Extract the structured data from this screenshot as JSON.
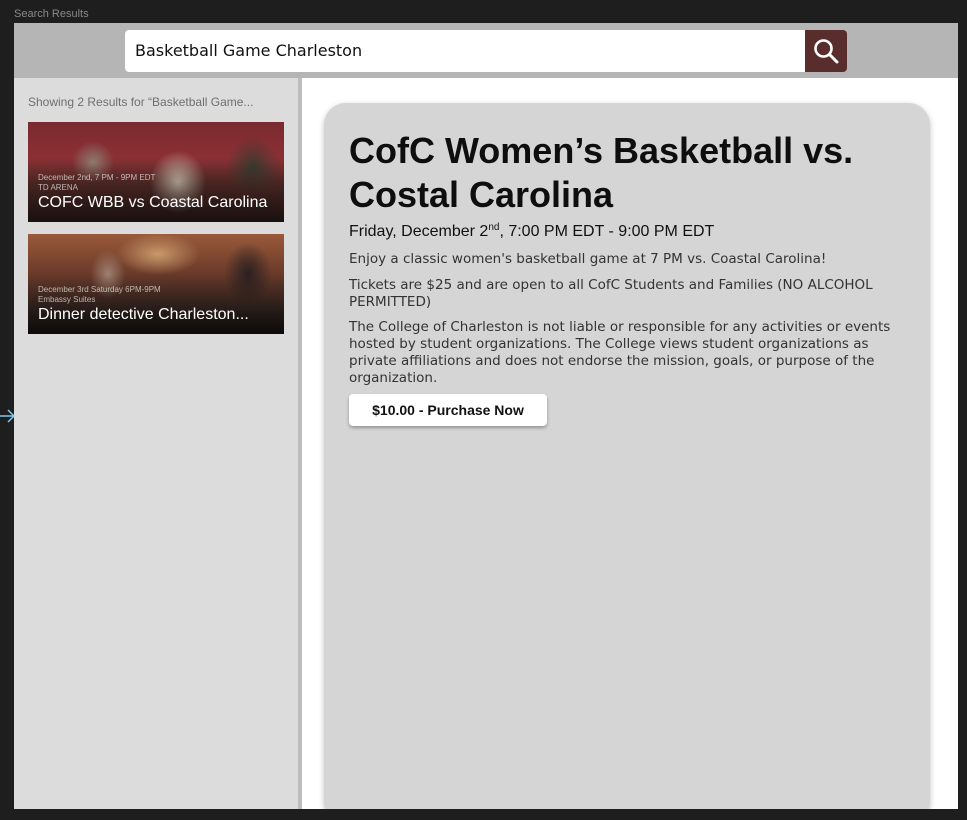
{
  "canvas": {
    "frame_label": "Search Results"
  },
  "search": {
    "value": "Basketball Game Charleston"
  },
  "sidebar": {
    "summary": "Showing 2 Results for “Basketball Game...",
    "results": [
      {
        "meta_line1": "December 2nd, 7 PM - 9PM EDT",
        "meta_line2": "TD ARENA",
        "title": "COFC WBB vs Coastal Carolina"
      },
      {
        "meta_line1": "December 3rd Saturday 6PM-9PM",
        "meta_line2": "Embassy Suites",
        "title": "Dinner detective Charleston..."
      }
    ]
  },
  "detail": {
    "title": "CofC Women’s Basketball vs. Costal Carolina",
    "time_prefix": "Friday, December 2",
    "time_sup": "nd",
    "time_suffix": ", 7:00 PM EDT - 9:00 PM EDT",
    "paragraphs": [
      "Enjoy a classic women's basketball game at 7 PM vs. Coastal Carolina!",
      "Tickets are $25 and are open to all CofC Students and Families (NO ALCOHOL PERMITTED)",
      "The College of Charleston is not liable or responsible for any activities or events hosted by student organizations. The College views student organizations as private affiliations and does not endorse the mission, goals, or purpose of the organization."
    ],
    "purchase_label": "$10.00 - Purchase Now"
  },
  "colors": {
    "canvas_bg": "#1e1e1e",
    "topbar_bg": "#b5b5b5",
    "search_button_bg": "#5a2d2d",
    "sidebar_bg": "#dcdcdc",
    "detail_card_bg": "#d5d5d5",
    "connector_arrow": "#7ec8f0"
  },
  "icons": {
    "search_button": "search-icon",
    "connector": "arrow-right-icon"
  }
}
